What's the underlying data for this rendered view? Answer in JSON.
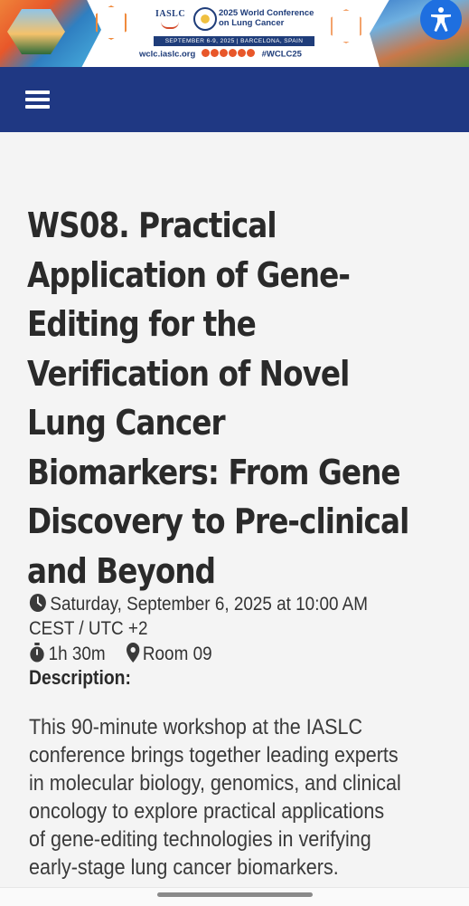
{
  "banner": {
    "org_logo": "IASLC",
    "conference_title_line1": "2025 World Conference",
    "conference_title_line2": "on Lung Cancer",
    "date_location": "SEPTEMBER 6-9, 2025  |  BARCELONA, SPAIN",
    "website": "wclc.iaslc.org",
    "hashtag": "#WCLC25",
    "accent_color": "#1f3d7a"
  },
  "accessibility_button": {
    "icon": "accessibility-icon"
  },
  "navbar": {
    "background": "#1f3883",
    "menu_icon": "hamburger-menu-icon"
  },
  "session": {
    "title": "WS08. Practical Application of Gene-Editing for the Verification of Novel Lung Cancer Biomarkers: From Gene Discovery to Pre-clinical and Beyond",
    "title_lines": [
      "WS08. Practical",
      "Application of Gene-",
      "Editing for the",
      "Verification of Novel",
      "Lung Cancer",
      "Biomarkers: From Gene",
      "Discovery to Pre-clinical",
      "and Beyond"
    ],
    "datetime_line1": "Saturday, September 6, 2025 at 10:00 AM",
    "datetime_line2": "CEST / UTC +2",
    "duration": "1h 30m",
    "room": "Room 09",
    "description_label": "Description:",
    "description_lines": [
      "This 90-minute workshop at the IASLC",
      "conference brings together leading experts",
      "in molecular biology, genomics, and clinical",
      "oncology to explore practical applications",
      "of gene-editing technologies in verifying",
      "early-stage lung cancer biomarkers."
    ]
  }
}
